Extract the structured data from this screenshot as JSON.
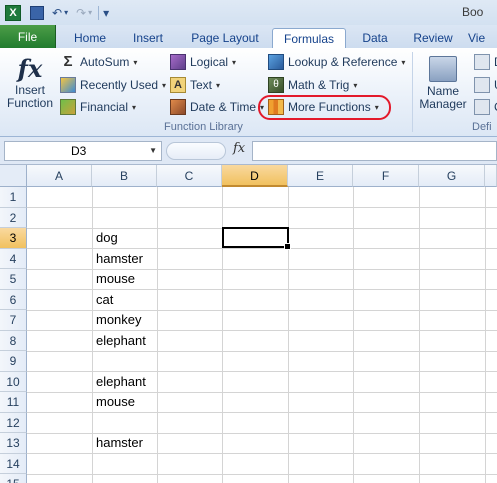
{
  "qat": {
    "title": "Boo",
    "excel_icon": "X",
    "undo": "↶",
    "redo": "↷",
    "customize": "▾"
  },
  "tabs": [
    "File",
    "Home",
    "Insert",
    "Page Layout",
    "Formulas",
    "Data",
    "Review",
    "Vie"
  ],
  "active_tab": "Formulas",
  "ribbon": {
    "insert_function": {
      "icon": "fx",
      "line1": "Insert",
      "line2": "Function"
    },
    "col1": [
      "AutoSum",
      "Recently Used",
      "Financial"
    ],
    "col2": [
      "Logical",
      "Text",
      "Date & Time"
    ],
    "col3": [
      "Lookup & Reference",
      "Math & Trig",
      "More Functions"
    ],
    "name_manager": {
      "line1": "Name",
      "line2": "Manager"
    },
    "partial_right": [
      "D",
      "U",
      "C"
    ],
    "group_label": "Function Library",
    "group_label_right": "Defi",
    "highlight_color": "#e3192b"
  },
  "formula_bar": {
    "name_box": "D3",
    "fx": "fx",
    "formula": ""
  },
  "grid": {
    "columns": [
      "A",
      "B",
      "C",
      "D",
      "E",
      "F",
      "G"
    ],
    "selected_column": "D",
    "rows": [
      "1",
      "2",
      "3",
      "4",
      "5",
      "6",
      "7",
      "8",
      "9",
      "10",
      "11",
      "12",
      "13",
      "14",
      "15"
    ],
    "selected_row": "3",
    "cells_b": {
      "3": "dog",
      "4": "hamster",
      "5": "mouse",
      "6": "cat",
      "7": "monkey",
      "8": "elephant",
      "10": "elephant",
      "11": "mouse",
      "13": "hamster"
    }
  }
}
